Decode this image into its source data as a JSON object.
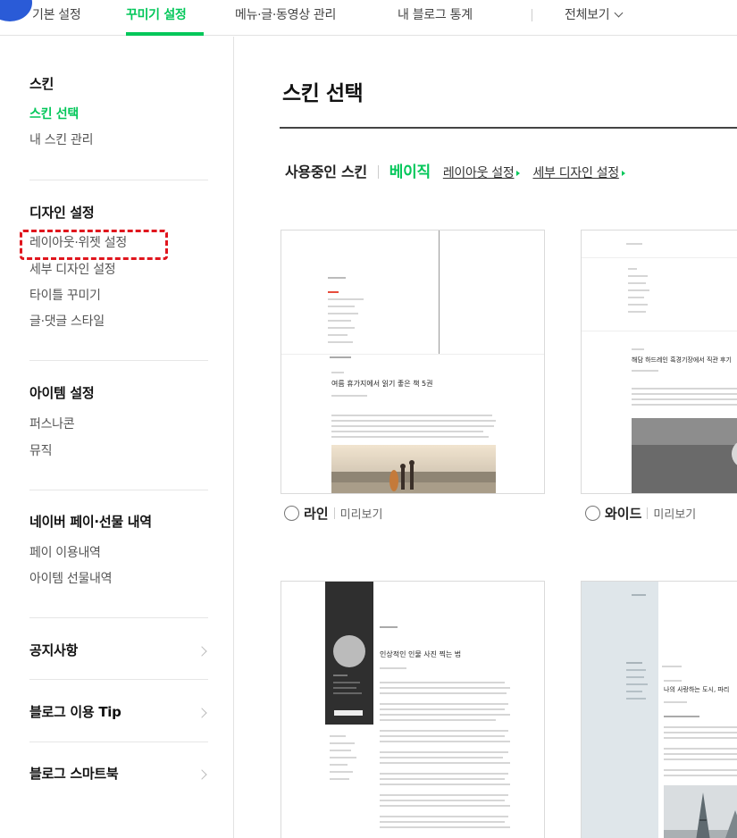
{
  "topnav": {
    "tabs": [
      {
        "label": "기본 설정"
      },
      {
        "label": "꾸미기 설정"
      },
      {
        "label": "메뉴·글·동영상 관리"
      },
      {
        "label": "내 블로그 통계"
      },
      {
        "label": "전체보기"
      }
    ]
  },
  "sidebar": {
    "skin_heading": "스킨",
    "skin_items": [
      "스킨 선택",
      "내 스킨 관리"
    ],
    "design_heading": "디자인 설정",
    "design_items": [
      "레이아웃·위젯 설정",
      "세부 디자인 설정",
      "타이틀 꾸미기",
      "글·댓글 스타일"
    ],
    "item_heading": "아이템 설정",
    "item_items": [
      "퍼스나콘",
      "뮤직"
    ],
    "pay_heading": "네이버 페이·선물 내역",
    "pay_items": [
      "페이 이용내역",
      "아이템 선물내역"
    ],
    "notice": "공지사항",
    "tip": "블로그 이용 Tip",
    "smartbook": "블로그 스마트북"
  },
  "main": {
    "title": "스킨 선택",
    "using_label": "사용중인 스킨",
    "current_skin": "베이직",
    "layout_link": "레이아웃 설정",
    "detail_link": "세부 디자인 설정",
    "preview_label": "미리보기",
    "skins": [
      {
        "name": "라인",
        "post_title": "여름 휴가지에서 읽기 좋은 책 5권"
      },
      {
        "name": "와이드",
        "post_title": "해담 하드레인 흑경기장에서 직관 후기"
      },
      {
        "name": "",
        "post_title": "인상적인 인물 사진 찍는 법"
      },
      {
        "name": "",
        "post_title": "나의 사랑하는 도시, 파리"
      }
    ]
  },
  "colors": {
    "accent": "#03c75a",
    "highlight_box": "#e0161e",
    "corner_dot": "#2a5bd7"
  }
}
